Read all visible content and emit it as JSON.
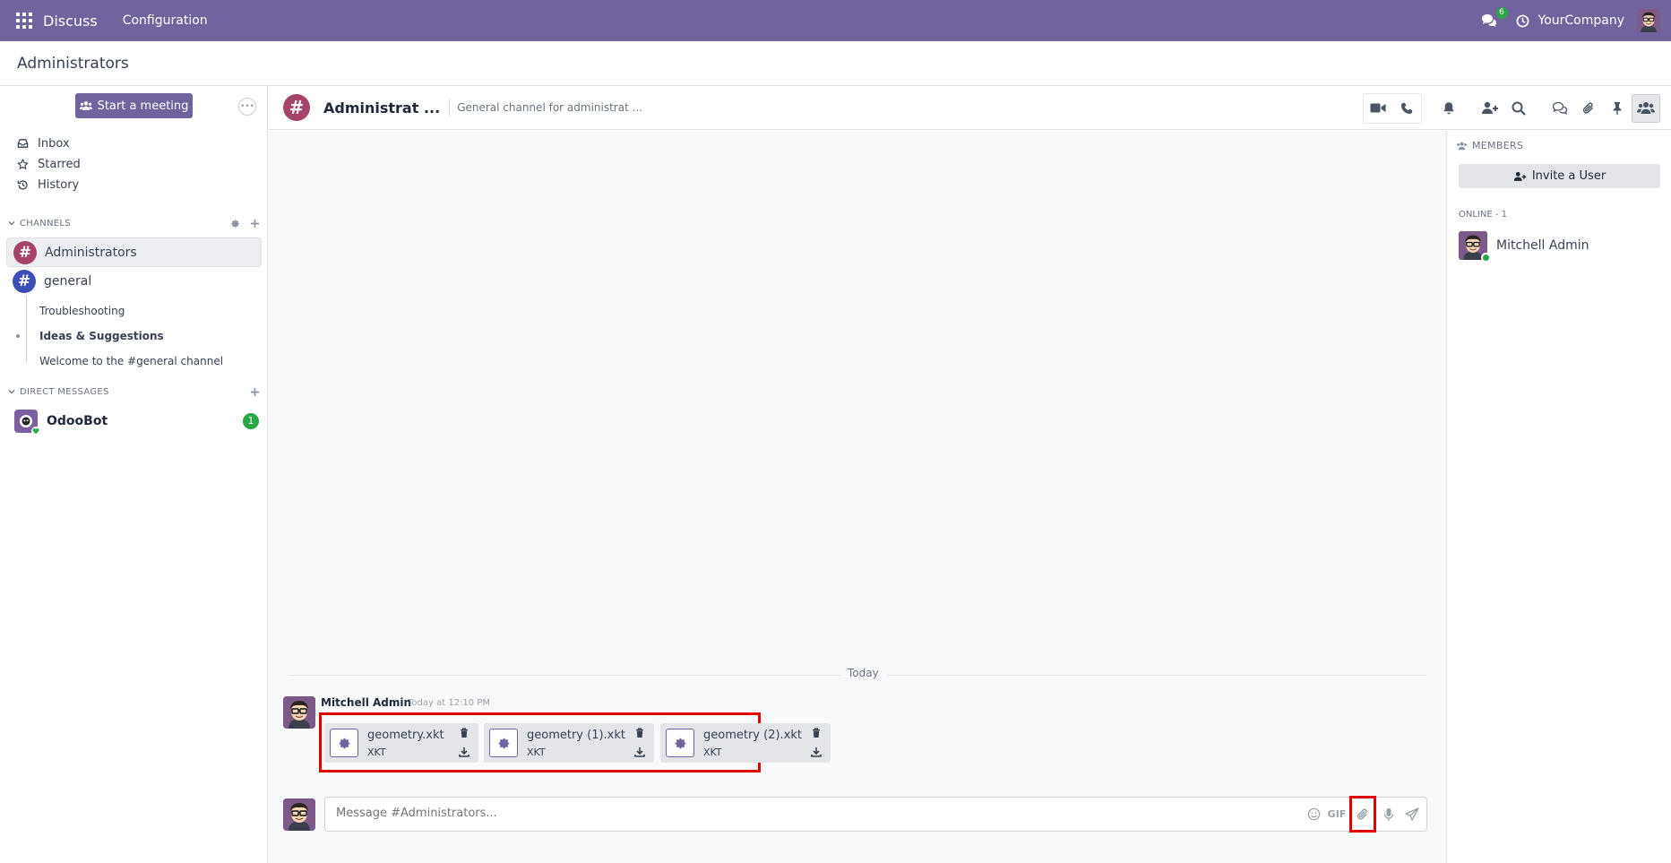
{
  "navbar": {
    "app_name": "Discuss",
    "menu_configuration": "Configuration",
    "chat_badge": "6",
    "company": "YourCompany",
    "color": "#71639e"
  },
  "breadcrumb": "Administrators",
  "sidebar": {
    "start_meeting": "Start a meeting",
    "mailboxes": [
      {
        "label": "Inbox",
        "icon": "inbox-icon"
      },
      {
        "label": "Starred",
        "icon": "star-icon"
      },
      {
        "label": "History",
        "icon": "history-icon"
      }
    ],
    "channels_header": "CHANNELS",
    "channels": [
      {
        "label": "Administrators",
        "active": true,
        "color": "#a6436b"
      },
      {
        "label": "general",
        "active": false,
        "color": "#3b4fb8"
      }
    ],
    "sub_threads": [
      {
        "label": "Troubleshooting",
        "bold": false
      },
      {
        "label": "Ideas & Suggestions",
        "bold": true
      },
      {
        "label": "Welcome to the #general channel",
        "bold": false
      }
    ],
    "dm_header": "DIRECT MESSAGES",
    "direct_messages": [
      {
        "label": "OdooBot",
        "badge": "1"
      }
    ]
  },
  "thread": {
    "title": "Administrat ...",
    "description": "General channel for administrat ...",
    "icon_glyph": "#",
    "day_separator": "Today",
    "message": {
      "author": "Mitchell Admin",
      "date": "Today at 12:10 PM",
      "attachments": [
        {
          "name": "geometry.xkt",
          "ext": "XKT"
        },
        {
          "name": "geometry (1).xkt",
          "ext": "XKT"
        },
        {
          "name": "geometry (2).xkt",
          "ext": "XKT"
        }
      ]
    },
    "composer_placeholder": "Message #Administrators...",
    "gif_label": "GIF"
  },
  "members": {
    "header": "MEMBERS",
    "invite": "Invite a User",
    "online_label": "ONLINE - 1",
    "list": [
      {
        "name": "Mitchell Admin",
        "status": "online"
      }
    ]
  }
}
